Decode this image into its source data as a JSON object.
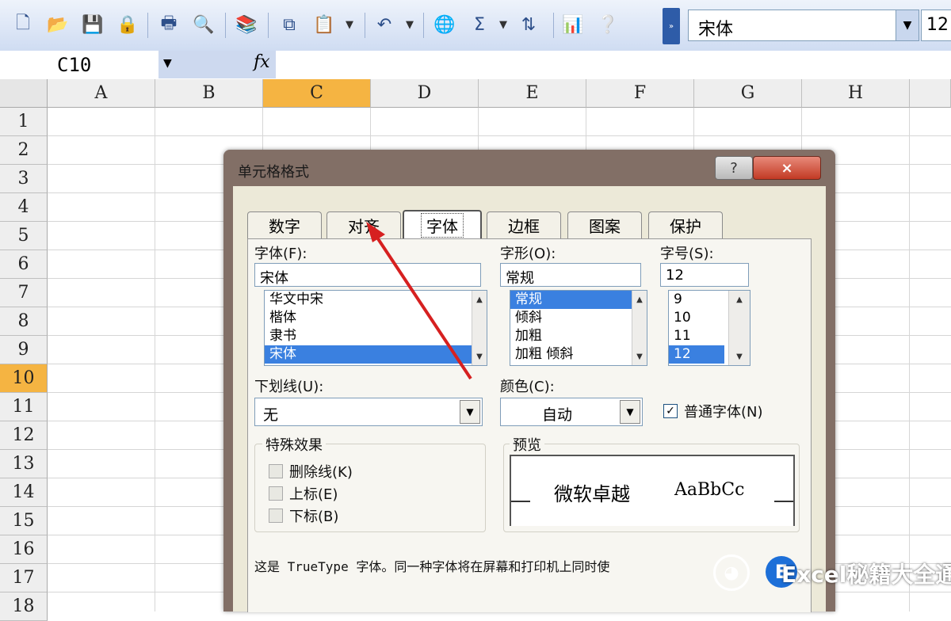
{
  "toolbar": {
    "buttons": [
      "new-icon",
      "open-icon",
      "save-icon",
      "permission-icon",
      "print-icon",
      "print-preview-icon",
      "research-icon",
      "copy-icon",
      "paste-icon",
      "undo-icon",
      "hyperlink-icon",
      "autosum-icon",
      "sort-icon",
      "chart-icon",
      "help-icon"
    ],
    "font_name": "宋体",
    "font_size": "12"
  },
  "formula_bar": {
    "name_box": "C10",
    "fx": "fx"
  },
  "sheet": {
    "columns": [
      "A",
      "B",
      "C",
      "D",
      "E",
      "F",
      "G",
      "H"
    ],
    "rows": [
      "1",
      "2",
      "3",
      "4",
      "5",
      "6",
      "7",
      "8",
      "9",
      "10",
      "11",
      "12",
      "13",
      "14",
      "15",
      "16",
      "17",
      "18"
    ],
    "selected_column": "C",
    "selected_row": "10"
  },
  "dialog": {
    "title": "单元格格式",
    "help": "?",
    "close": "×",
    "tabs": [
      "数字",
      "对齐",
      "字体",
      "边框",
      "图案",
      "保护"
    ],
    "active_tab": "字体",
    "font_label": "字体(F):",
    "font_value": "宋体",
    "font_list": [
      "华文中宋",
      "楷体",
      "隶书",
      "宋体"
    ],
    "style_label": "字形(O):",
    "style_value": "常规",
    "style_list": [
      "常规",
      "倾斜",
      "加粗",
      "加粗 倾斜"
    ],
    "size_label": "字号(S):",
    "size_value": "12",
    "size_list": [
      "9",
      "10",
      "11",
      "12"
    ],
    "underline_label": "下划线(U):",
    "underline_value": "无",
    "color_label": "颜色(C):",
    "color_value": "自动",
    "normal_font_label": "普通字体(N)",
    "effects_label": "特殊效果",
    "strikethrough_label": "删除线(K)",
    "superscript_label": "上标(E)",
    "subscript_label": "下标(B)",
    "preview_label": "预览",
    "preview_cn": "微软卓越",
    "preview_en": "AaBbCc",
    "footer_text": "这是 TrueType 字体。同一种字体将在屏幕和打印机上同时使"
  },
  "watermark": {
    "text": "Excel秘籍大全通"
  },
  "colors": {
    "selection_orange": "#f5b442",
    "list_selection": "#3a80e0",
    "arrow_red": "#d62020"
  }
}
